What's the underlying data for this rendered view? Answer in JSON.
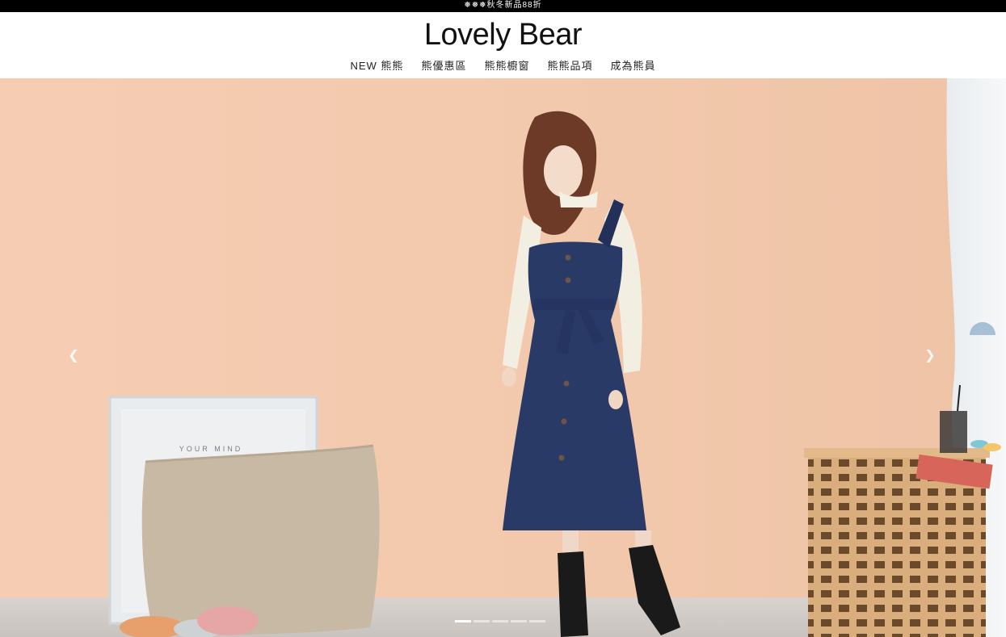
{
  "announcement": "❅❅❅秋冬新品88折",
  "brand": {
    "logo_text": "Lovely Bear"
  },
  "nav": {
    "items": [
      {
        "label": "NEW 熊熊"
      },
      {
        "label": "熊優惠區"
      },
      {
        "label": "熊熊櫥窗"
      },
      {
        "label": "熊熊品項"
      },
      {
        "label": "成為熊員"
      }
    ]
  },
  "hero": {
    "prev_icon": "chevron-left-icon",
    "next_icon": "chevron-right-icon",
    "frame_text": "YOUR MIND",
    "slide_count": 5,
    "active_slide": 1
  },
  "colors": {
    "announcement_bg": "#000000",
    "wall": "#f2c9ae",
    "dress": "#2a3a66"
  }
}
